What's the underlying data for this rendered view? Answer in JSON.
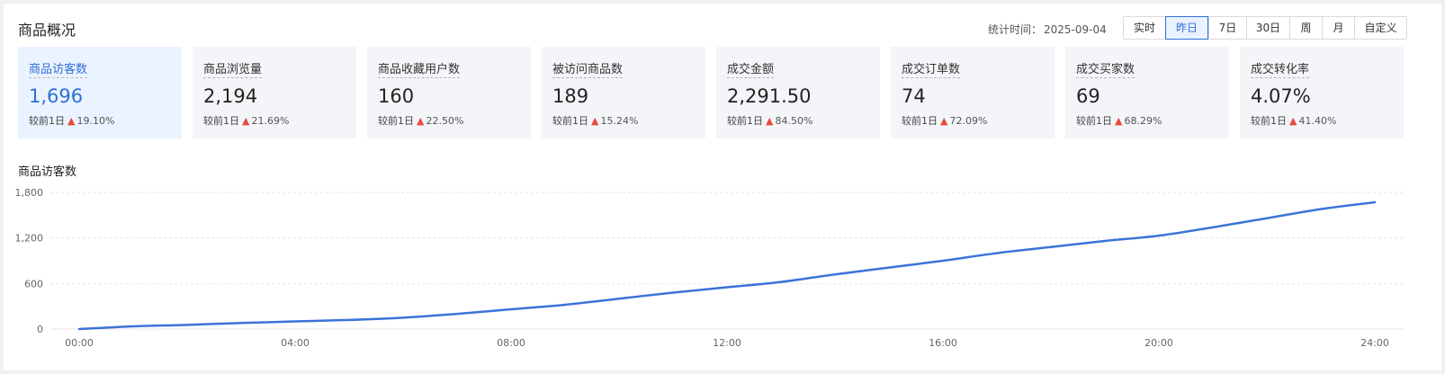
{
  "header": {
    "title": "商品概况",
    "stat_time_label": "统计时间：",
    "stat_time_value": "2025-09-04"
  },
  "tabs": [
    {
      "label": "实时",
      "active": false
    },
    {
      "label": "昨日",
      "active": true
    },
    {
      "label": "7日",
      "active": false
    },
    {
      "label": "30日",
      "active": false
    },
    {
      "label": "周",
      "active": false
    },
    {
      "label": "月",
      "active": false
    },
    {
      "label": "自定义",
      "active": false
    }
  ],
  "cards": [
    {
      "label": "商品访客数",
      "value": "1,696",
      "compare": "较前1日",
      "change": "19.10%",
      "active": true
    },
    {
      "label": "商品浏览量",
      "value": "2,194",
      "compare": "较前1日",
      "change": "21.69%",
      "active": false
    },
    {
      "label": "商品收藏用户数",
      "value": "160",
      "compare": "较前1日",
      "change": "22.50%",
      "active": false
    },
    {
      "label": "被访问商品数",
      "value": "189",
      "compare": "较前1日",
      "change": "15.24%",
      "active": false
    },
    {
      "label": "成交金额",
      "value": "2,291.50",
      "compare": "较前1日",
      "change": "84.50%",
      "active": false
    },
    {
      "label": "成交订单数",
      "value": "74",
      "compare": "较前1日",
      "change": "72.09%",
      "active": false
    },
    {
      "label": "成交买家数",
      "value": "69",
      "compare": "较前1日",
      "change": "68.29%",
      "active": false
    },
    {
      "label": "成交转化率",
      "value": "4.07%",
      "compare": "较前1日",
      "change": "41.40%",
      "active": false
    }
  ],
  "chart_data": {
    "type": "line",
    "title": "商品访客数",
    "x": [
      "00:00",
      "01:00",
      "02:00",
      "03:00",
      "04:00",
      "05:00",
      "06:00",
      "07:00",
      "08:00",
      "09:00",
      "10:00",
      "11:00",
      "12:00",
      "13:00",
      "14:00",
      "15:00",
      "16:00",
      "17:00",
      "18:00",
      "19:00",
      "20:00",
      "21:00",
      "22:00",
      "23:00",
      "24:00"
    ],
    "x_tick_labels": [
      "00:00",
      "04:00",
      "08:00",
      "12:00",
      "16:00",
      "20:00",
      "24:00"
    ],
    "y_tick_labels": [
      "1,800",
      "1,200",
      "600",
      "0"
    ],
    "series": [
      {
        "values": [
          0,
          35,
          55,
          80,
          100,
          120,
          150,
          200,
          260,
          320,
          400,
          480,
          550,
          620,
          720,
          810,
          900,
          1000,
          1080,
          1160,
          1230,
          1340,
          1460,
          1580,
          1670
        ]
      }
    ],
    "ylim": [
      0,
      1800
    ],
    "grid": true,
    "line_color": "#3b73d9",
    "grid_color": "#e4e6ea"
  },
  "icons": {
    "arrow": "▲"
  }
}
